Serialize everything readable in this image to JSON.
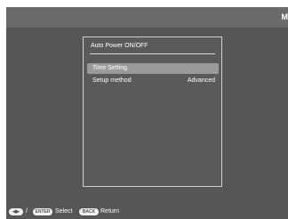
{
  "top_bar": {
    "icon": "memory-card-icon",
    "icon_text": "M"
  },
  "menu": {
    "title": "Auto Power ON/OFF",
    "options": [
      {
        "label": "Time Setting",
        "value": "",
        "selected": true
      },
      {
        "label": "Setup method",
        "value": "Advanced",
        "selected": false
      }
    ]
  },
  "bottom_bar": {
    "nav_key_text": "◀▶",
    "separator": "/",
    "enter_key_text": "ENTER",
    "select_label": "Select",
    "back_key_text": "BACK",
    "return_label": "Return"
  },
  "colors": {
    "screen_bg": "#565656",
    "panel_border": "#cfcfcf",
    "selected_row": "#9a9a9a",
    "text": "#ffffff"
  }
}
